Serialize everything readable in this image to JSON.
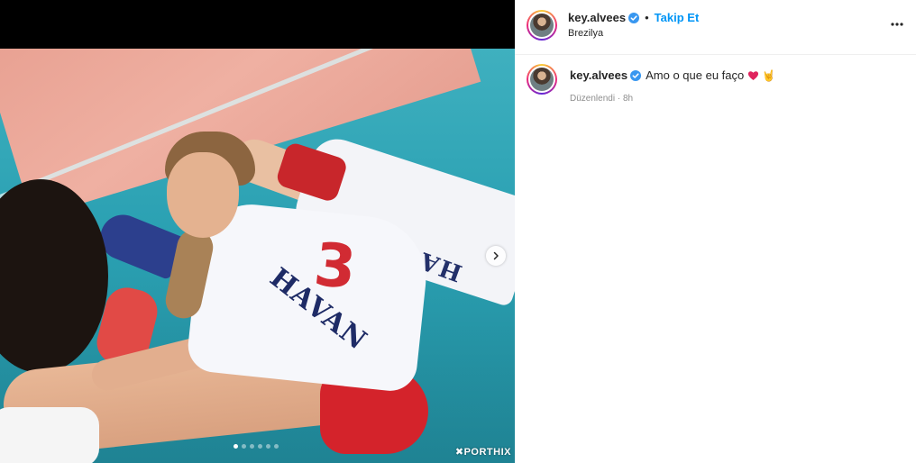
{
  "post": {
    "username": "key.alvees",
    "separator": "•",
    "follow_label": "Takip Et",
    "location": "Brezilya",
    "caption": "Amo o que eu faço",
    "caption_emoji_hand": "🤘",
    "edited_label": "Düzenlendi",
    "meta_separator": "·",
    "time_ago": "8h"
  },
  "media": {
    "watermark": "✖PORTHIX",
    "slide_count": 6,
    "active_slide": 1,
    "jersey_number": "3",
    "jersey_text": "HAVAN",
    "lying_jersey_text": "HAVAN"
  },
  "colors": {
    "follow_blue": "#0095f6",
    "verified_blue": "#3897f0",
    "heart_red": "#e0245e"
  },
  "icons": {
    "verified": "verified-badge-icon",
    "more": "more-options-icon",
    "next": "chevron-right-icon",
    "heart": "heart-icon"
  }
}
